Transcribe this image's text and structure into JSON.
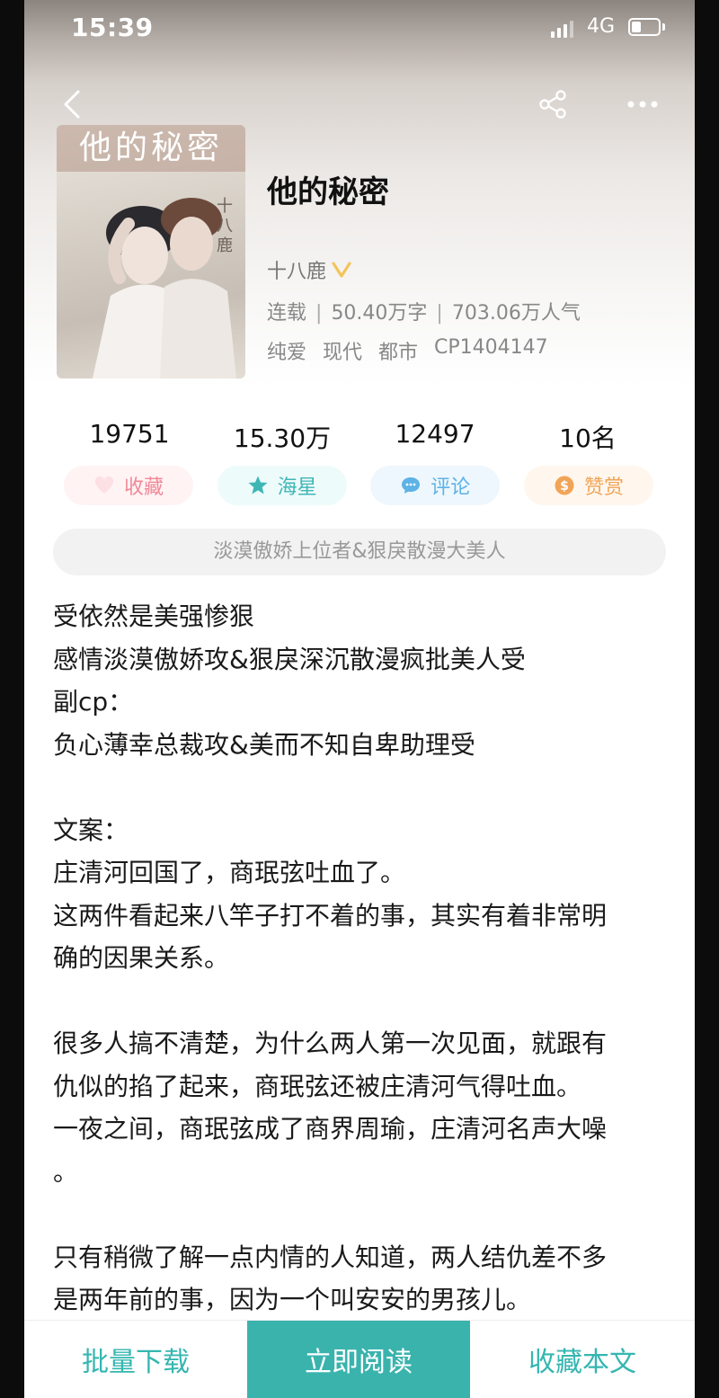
{
  "status_bar": {
    "time": "15:39",
    "network": "4G",
    "battery_level": 0.35
  },
  "nav": {
    "back_icon": "chevron-left-icon",
    "share_icon": "share-icon",
    "more_icon": "more-dots-icon"
  },
  "book": {
    "cover_title": "他的秘密",
    "cover_author": "十八鹿",
    "title": "他的秘密",
    "author": "十八鹿",
    "status": "连载",
    "word_count": "50.40万字",
    "popularity": "703.06万人气",
    "tags": [
      "纯爱",
      "现代",
      "都市",
      "CP1404147"
    ]
  },
  "stats": [
    "19751",
    "15.30万",
    "12497",
    "10名"
  ],
  "actions": [
    {
      "label": "收藏",
      "icon": "heart-icon",
      "color": "#f08a98"
    },
    {
      "label": "海星",
      "icon": "star-icon",
      "color": "#3fb6b6"
    },
    {
      "label": "评论",
      "icon": "comment-icon",
      "color": "#5db2e6"
    },
    {
      "label": "赞赏",
      "icon": "coin-icon",
      "color": "#f2a456"
    }
  ],
  "summary": "淡漠傲娇上位者&狠戾散漫大美人",
  "description": [
    "受依然是美强惨狠",
    "感情淡漠傲娇攻&狠戾深沉散漫疯批美人受",
    "副cp：",
    "负心薄幸总裁攻&美而不知自卑助理受",
    "",
    "文案：",
    "庄清河回国了，商珉弦吐血了。",
    "这两件看起来八竿子打不着的事，其实有着非常明",
    "确的因果关系。",
    "",
    "很多人搞不清楚，为什么两人第一次见面，就跟有",
    "仇似的掐了起来，商珉弦还被庄清河气得吐血。",
    "一夜之间，商珉弦成了商界周瑜，庄清河名声大噪",
    "。",
    "",
    "只有稍微了解一点内情的人知道，两人结仇差不多",
    "是两年前的事，因为一个叫安安的男孩儿。"
  ],
  "bottom_bar": {
    "download": "批量下载",
    "read": "立即阅读",
    "collect": "收藏本文"
  },
  "colors": {
    "accent": "#3ab3ad",
    "accent_text": "#35b6b0"
  }
}
